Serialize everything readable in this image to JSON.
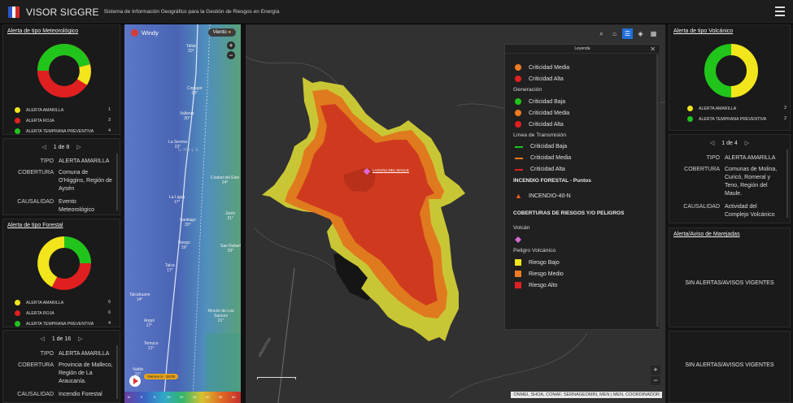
{
  "header": {
    "title": "VISOR SIGGRE",
    "subtitle": "Sistema de Información Geográfico para la Gestión de Riesgos en Energía"
  },
  "colors": {
    "red": "#e02020",
    "green": "#21c41b",
    "yellow": "#f2e51c",
    "orange": "#ee7b22"
  },
  "meteo": {
    "title": "Alerta de tipo Meteorológico",
    "legend": [
      {
        "label": "ALERTA AMARILLA",
        "count": "1",
        "color": "#f2e51c"
      },
      {
        "label": "ALERTA ROJA",
        "count": "3",
        "color": "#e02020"
      },
      {
        "label": "ALERTA TEMPRANA PREVENTIVA",
        "count": "4",
        "color": "#21c41b"
      }
    ],
    "pager": "1 de 8",
    "tipo_k": "TIPO",
    "tipo": "ALERTA AMARILLA",
    "cob_k": "COBERTURA",
    "cobertura": [
      "Comuna de",
      "O'Higgins, Región de",
      "Aysén"
    ],
    "caus_k": "CAUSALIDAD",
    "causalidad": [
      "Evento",
      "Meteorológico"
    ]
  },
  "forestal": {
    "title": "Alerta de tipo Forestal",
    "legend": [
      {
        "label": "ALERTA AMARILLA",
        "count": "6",
        "color": "#f2e51c"
      },
      {
        "label": "ALERTA ROJA",
        "count": "6",
        "color": "#e02020"
      },
      {
        "label": "ALERTA TEMPRANA PREVENTIVA",
        "count": "4",
        "color": "#21c41b"
      }
    ],
    "pager": "1 de 16",
    "tipo_k": "TIPO",
    "tipo": "ALERTA AMARILLA",
    "cob_k": "COBERTURA",
    "cobertura": [
      "Provincia de Malleco,",
      "Región de La",
      "Araucanía."
    ],
    "caus_k": "CAUSALIDAD",
    "causalidad": "Incendio Forestal"
  },
  "volcanico": {
    "title": "Alerta de tipo Volcánico",
    "legend": [
      {
        "label": "ALERTA AMARILLA",
        "count": "2",
        "color": "#f2e51c"
      },
      {
        "label": "ALERTA TEMPRANA PREVENTIVA",
        "count": "2",
        "color": "#21c41b"
      }
    ],
    "pager": "1 de 4",
    "tipo_k": "TIPO",
    "tipo": "ALERTA AMARILLA",
    "cob_k": "COBERTURA",
    "cobertura": [
      "Comunas de Molina,",
      "Curicó, Romeral y",
      "Teno, Región del",
      "Maule."
    ],
    "caus_k": "CAUSALIDAD",
    "causalidad": [
      "Actividad del",
      "Complejo Volcánico"
    ]
  },
  "marejadas": {
    "title": "Alerta/Aviso de Marejadas",
    "empty": "SIN ALERTAS/AVISOS VIGENTES"
  },
  "empty2": "SIN ALERTAS/AVISOS VIGENTES",
  "windy": {
    "logo": "Windy",
    "mode": "Viento",
    "time": "Viernes 8 - 18:00",
    "scale": [
      "kt",
      "0",
      "5",
      "10",
      "20",
      "30",
      "40",
      "50",
      "60"
    ],
    "cities": [
      "Taltal",
      "Copiapó",
      "Vallenar",
      "La Serena",
      "Ciudad del Este",
      "La Ligua",
      "Santiago",
      "Junín",
      "Rengo",
      "San Rafael",
      "Talca",
      "Talcahuano",
      "Rincón de Los Sauces",
      "Angol",
      "Temuco",
      "Valdiv"
    ],
    "temps": [
      "20°",
      "20°",
      "20°",
      "22°",
      "24°",
      "17°",
      "20°",
      "31°",
      "19°",
      "29°",
      "17°",
      "14°",
      "21°",
      "17°",
      "21°",
      "21°"
    ],
    "country": "CHILE"
  },
  "map": {
    "volcano_label": "LAGUNA DEL MAULE",
    "attribution": "ONMEI, SHOA, CONAF, SERNAGEOMIN, MEN | MEN, COORDINADOR",
    "road": "ARGENTINA",
    "tools": [
      "search-icon",
      "home-icon",
      "list-icon",
      "layers-icon",
      "grid-icon"
    ]
  },
  "legend": {
    "title": "Leyenda",
    "items": [
      {
        "type": "circ",
        "color": "#ee7b22",
        "label": "Criticidad Media"
      },
      {
        "type": "circ",
        "color": "#e02020",
        "label": "Criticidad Alta"
      },
      {
        "type": "head",
        "label": "Generación"
      },
      {
        "type": "circ",
        "color": "#21c41b",
        "label": "Criticidad Baja"
      },
      {
        "type": "circ",
        "color": "#ee7b22",
        "label": "Criticidad Media"
      },
      {
        "type": "circ",
        "color": "#e02020",
        "label": "Criticidad Alta"
      },
      {
        "type": "head",
        "label": "Línea de Transmisión"
      },
      {
        "type": "line",
        "color": "#21c41b",
        "label": "Criticidad Baja"
      },
      {
        "type": "line",
        "color": "#ee7b22",
        "label": "Criticidad Media"
      },
      {
        "type": "line",
        "color": "#e02020",
        "label": "Criticidad Alta"
      },
      {
        "type": "bold",
        "label": "INCENDIO FORESTAL - Puntos"
      },
      {
        "type": "fire",
        "color": "#ee5a1c",
        "label": "INCENDIO-40-N"
      },
      {
        "type": "bold",
        "label": "COBERTURAS DE RIESGOS Y/O PELIGROS"
      },
      {
        "type": "head",
        "label": "Volcán"
      },
      {
        "type": "diamond",
        "color": "#d86bd8",
        "label": ""
      },
      {
        "type": "head",
        "label": "Peligro Volcánico"
      },
      {
        "type": "sq",
        "color": "#f2e51c",
        "label": "Riesgo Bajo"
      },
      {
        "type": "sq",
        "color": "#ee7b22",
        "label": "Riesgo Medio"
      },
      {
        "type": "sq",
        "color": "#e02020",
        "label": "Riesgo Alto"
      }
    ]
  }
}
